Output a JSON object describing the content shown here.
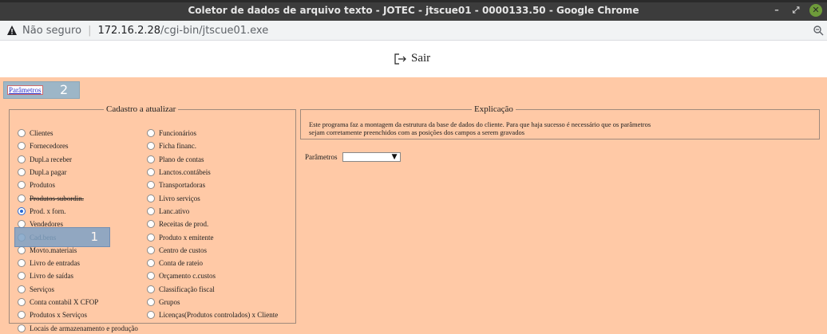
{
  "window": {
    "title": "Coletor de dados de arquivo texto - JOTEC - jtscue01 - 0000133.50 - Google Chrome"
  },
  "address_bar": {
    "security_label": "Não seguro",
    "host": "172.16.2.28",
    "path": "/cgi-bin/jtscue01.exe"
  },
  "top": {
    "sair_label": "Sair"
  },
  "params_tab": {
    "link_label": "Parâmetros",
    "annotation": "2"
  },
  "cadastro": {
    "legend": "Cadastro a atualizar",
    "col1": [
      {
        "label": "Clientes"
      },
      {
        "label": "Fornecedores"
      },
      {
        "label": "Dupl.a receber"
      },
      {
        "label": "Dupl.a pagar"
      },
      {
        "label": "Produtos"
      },
      {
        "label": "Produtos subordin."
      },
      {
        "label": "Prod. x forn."
      },
      {
        "label": "Vendedores"
      },
      {
        "label": "Cad.bens"
      },
      {
        "label": "Movto.materiais"
      },
      {
        "label": "Livro de entradas"
      },
      {
        "label": "Livro de saídas"
      },
      {
        "label": "Serviços"
      },
      {
        "label": "Conta contabil X CFOP"
      },
      {
        "label": "Produtos x Serviços"
      },
      {
        "label": "Locais de armazenamento e produção"
      }
    ],
    "col2": [
      {
        "label": "Funcionários"
      },
      {
        "label": "Ficha financ."
      },
      {
        "label": "Plano de contas"
      },
      {
        "label": "Lanctos.contábeis"
      },
      {
        "label": "Transportadoras"
      },
      {
        "label": "Livro serviços"
      },
      {
        "label": "Lanc.ativo"
      },
      {
        "label": "Receitas de prod."
      },
      {
        "label": "Produto x emitente"
      },
      {
        "label": "Centro de custos"
      },
      {
        "label": "Conta de rateio"
      },
      {
        "label": "Orçamento c.custos"
      },
      {
        "label": "Classificação fiscal"
      },
      {
        "label": "Grupos"
      },
      {
        "label": "Licenças(Produtos controlados) x Cliente"
      }
    ],
    "selected": "Prod. x forn.",
    "selection_annotation": "1"
  },
  "explicacao": {
    "legend": "Explicação",
    "text": "Este programa faz a montagem da estrutura da base de dados do cliente. Para que haja sucesso é necessário que os parâmetros sejam corretamente preenchidos com as posições dos campos a serem gravados"
  },
  "parametros_field": {
    "label": "Parâmetros",
    "value": ""
  },
  "colors": {
    "page_background": "#ffc9a6",
    "titlebar": "#3c3c3c",
    "annotation_box": "#7ea2c6"
  }
}
